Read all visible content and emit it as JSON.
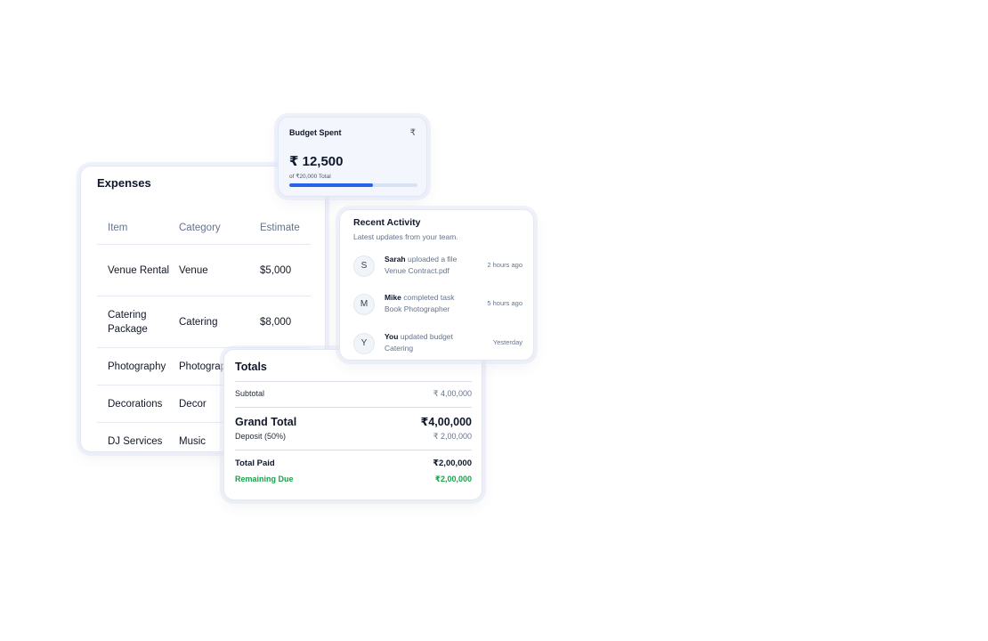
{
  "expenses": {
    "title": "Expenses",
    "columns": [
      "Item",
      "Category",
      "Estimate"
    ],
    "rows": [
      {
        "item": "Venue Rental",
        "category": "Venue",
        "estimate": "$5,000"
      },
      {
        "item": "Catering Package",
        "category": "Catering",
        "estimate": "$8,000"
      },
      {
        "item": "Photography",
        "category": "Photography",
        "estimate": ""
      },
      {
        "item": "Decorations",
        "category": "Decor",
        "estimate": ""
      },
      {
        "item": "DJ Services",
        "category": "Music",
        "estimate": ""
      }
    ]
  },
  "budget": {
    "title": "Budget Spent",
    "currency_symbol": "₹",
    "amount": "₹ 12,500",
    "subtext": "of ₹20,000 Total",
    "progress_fraction": 0.65,
    "bar_color": "#2563eb"
  },
  "activity": {
    "title": "Recent Activity",
    "subtitle": "Latest updates from your team.",
    "items": [
      {
        "initial": "S",
        "actor": "Sarah",
        "action": "uploaded a file",
        "target": "Venue Contract.pdf",
        "time": "2 hours ago"
      },
      {
        "initial": "M",
        "actor": "Mike",
        "action": "completed task",
        "target": "Book Photographer",
        "time": "5 hours ago"
      },
      {
        "initial": "Y",
        "actor": "You",
        "action": "updated budget",
        "target": "Catering",
        "time": "Yesterday"
      }
    ]
  },
  "totals": {
    "title": "Totals",
    "subtotal_label": "Subtotal",
    "subtotal_value": "₹ 4,00,000",
    "grand_total_label": "Grand Total",
    "grand_total_value": "₹4,00,000",
    "deposit_label": "Deposit (50%)",
    "deposit_value": "₹ 2,00,000",
    "total_paid_label": "Total Paid",
    "total_paid_value": "₹2,00,000",
    "remaining_due_label": "Remaining Due",
    "remaining_due_value": "₹2,00,000",
    "remaining_color": "#16a34a"
  }
}
